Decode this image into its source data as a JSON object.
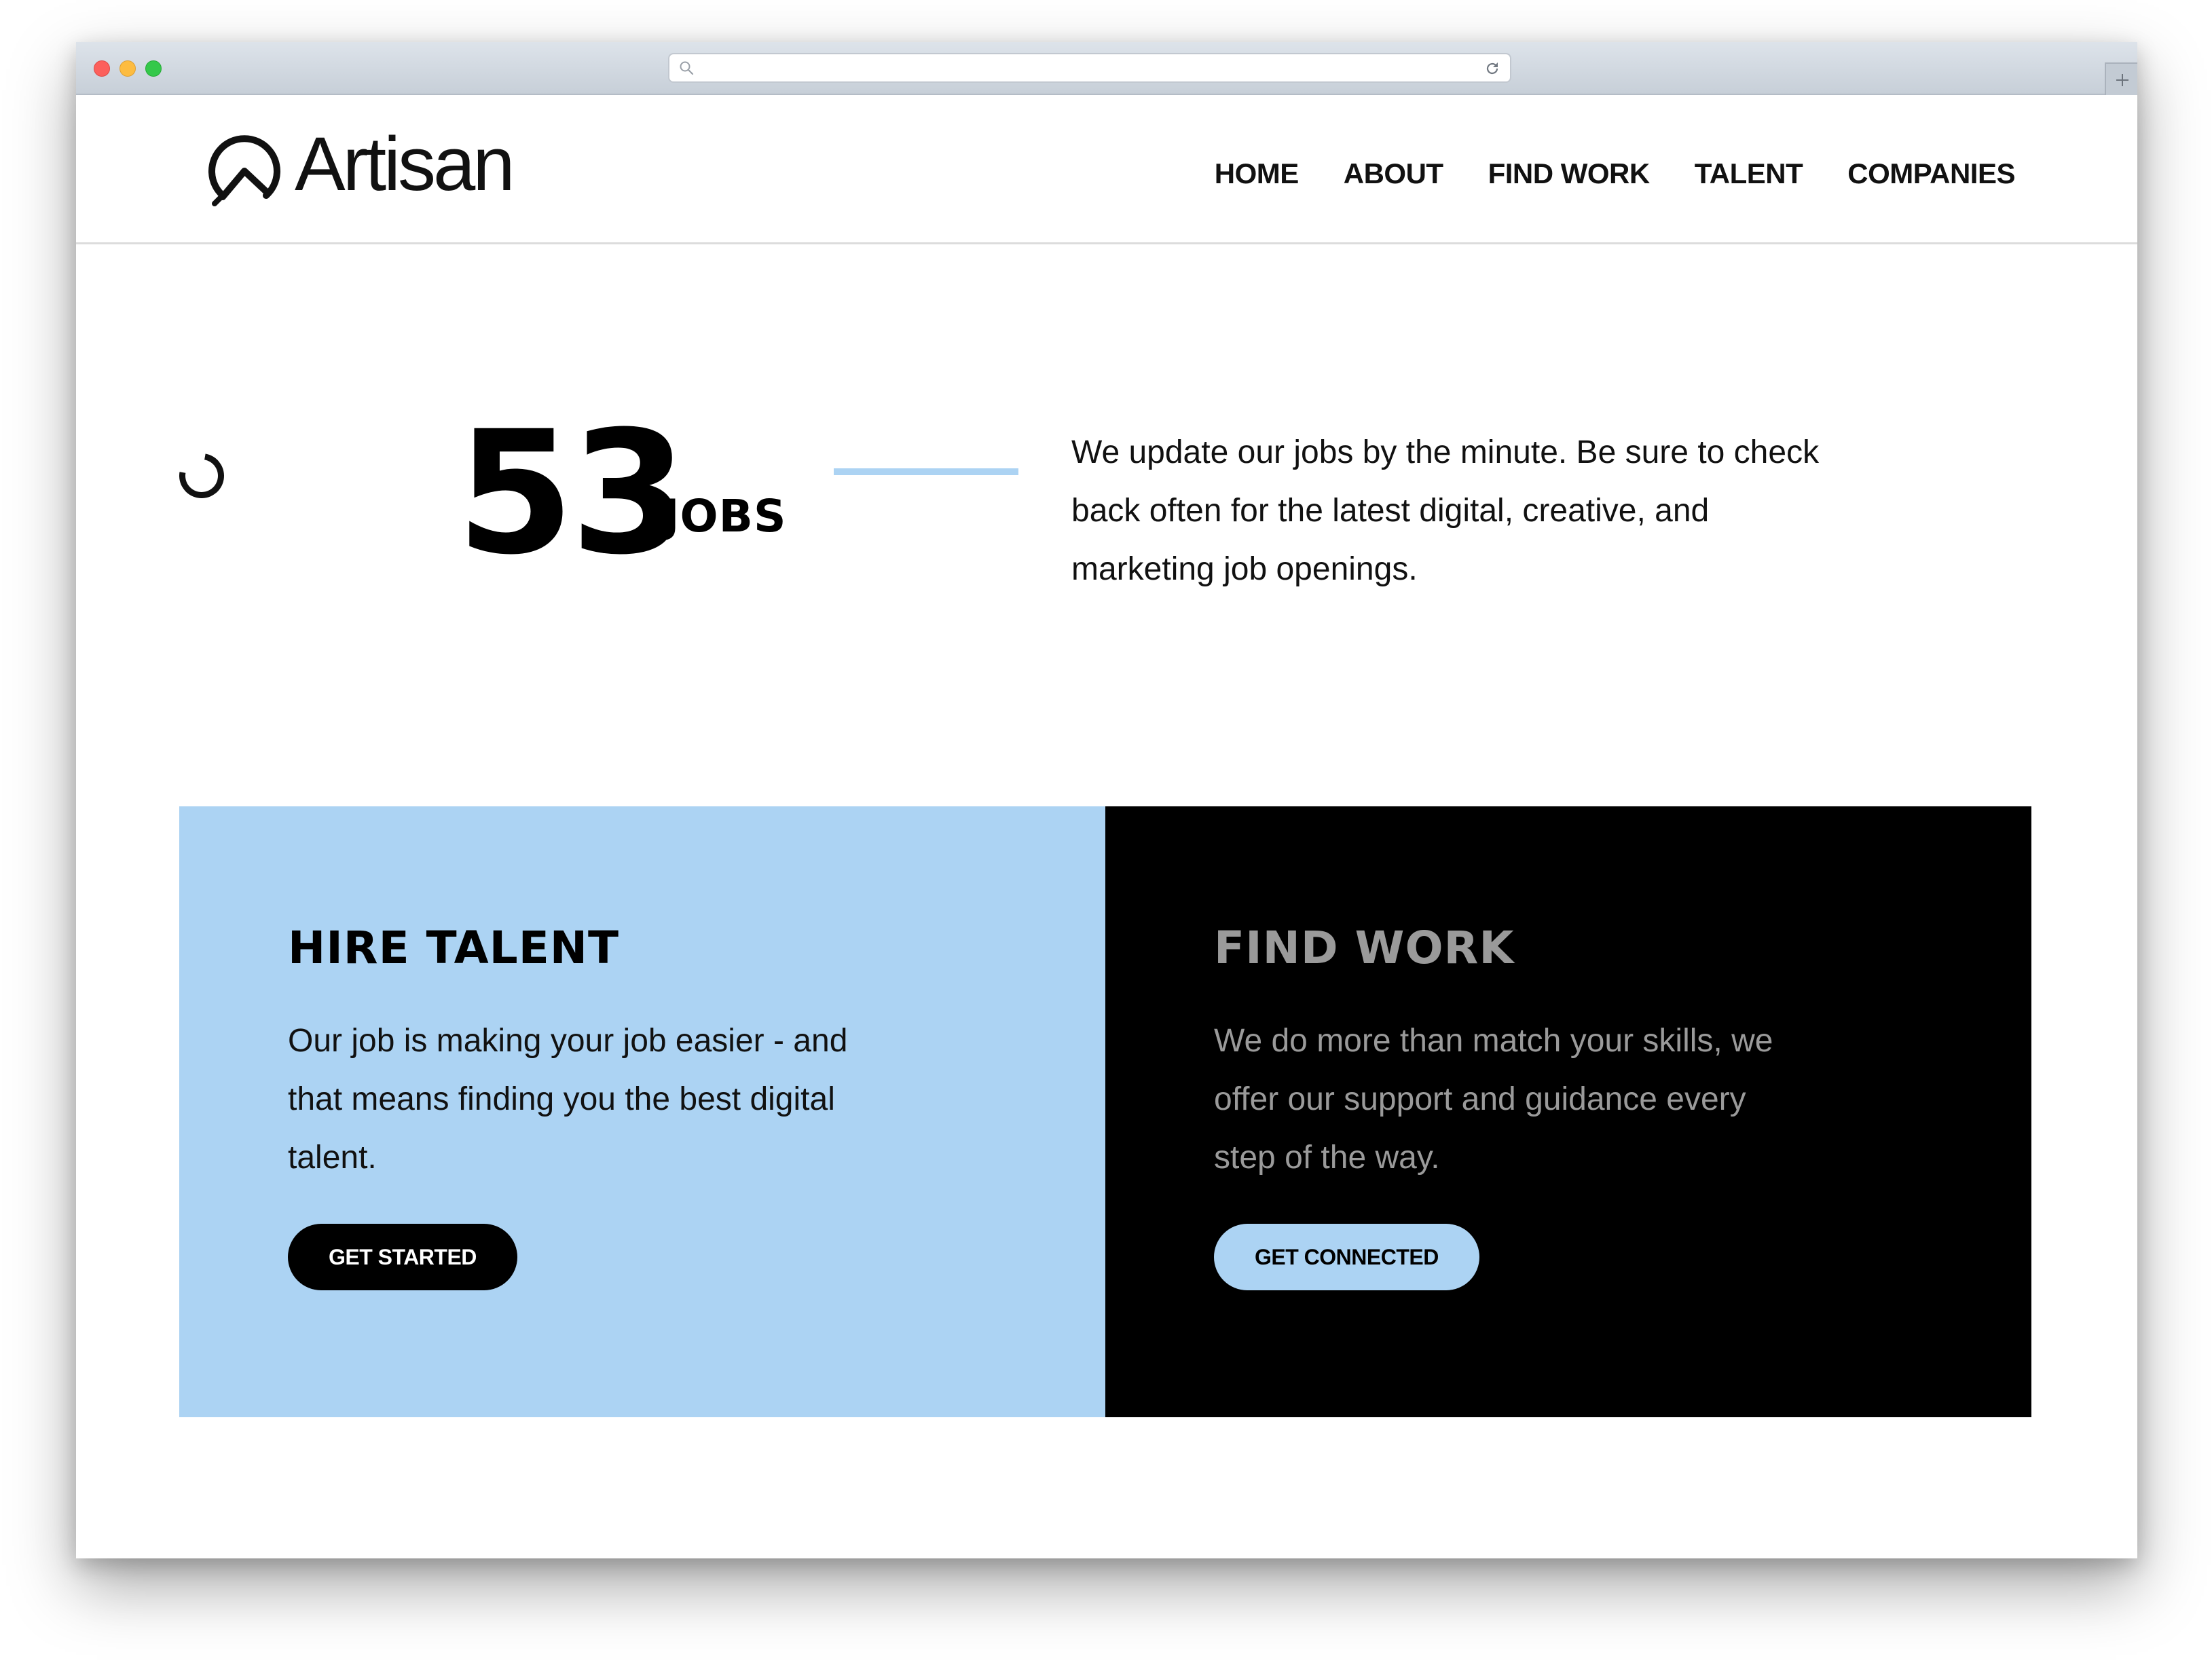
{
  "browser": {
    "url": ""
  },
  "site": {
    "logo_text": "Artisan",
    "nav": [
      "HOME",
      "ABOUT",
      "FIND WORK",
      "TALENT",
      "COMPANIES"
    ]
  },
  "stats": {
    "count": "53",
    "label": "JOBS",
    "description": "We update our jobs by the minute. Be sure to check back often for the latest digital, creative, and marketing job openings."
  },
  "cards": {
    "hire": {
      "title": "HIRE TALENT",
      "text": "Our job is making your job easier - and that means finding you the best digital talent.",
      "button": "GET STARTED"
    },
    "find": {
      "title": "FIND WORK",
      "text": "We do more than match your skills, we offer our support and guidance every step of the way.",
      "button": "GET CONNECTED"
    }
  },
  "colors": {
    "accent_blue": "#acd3f3",
    "black": "#000000",
    "muted_gray": "#9a9a9a"
  }
}
